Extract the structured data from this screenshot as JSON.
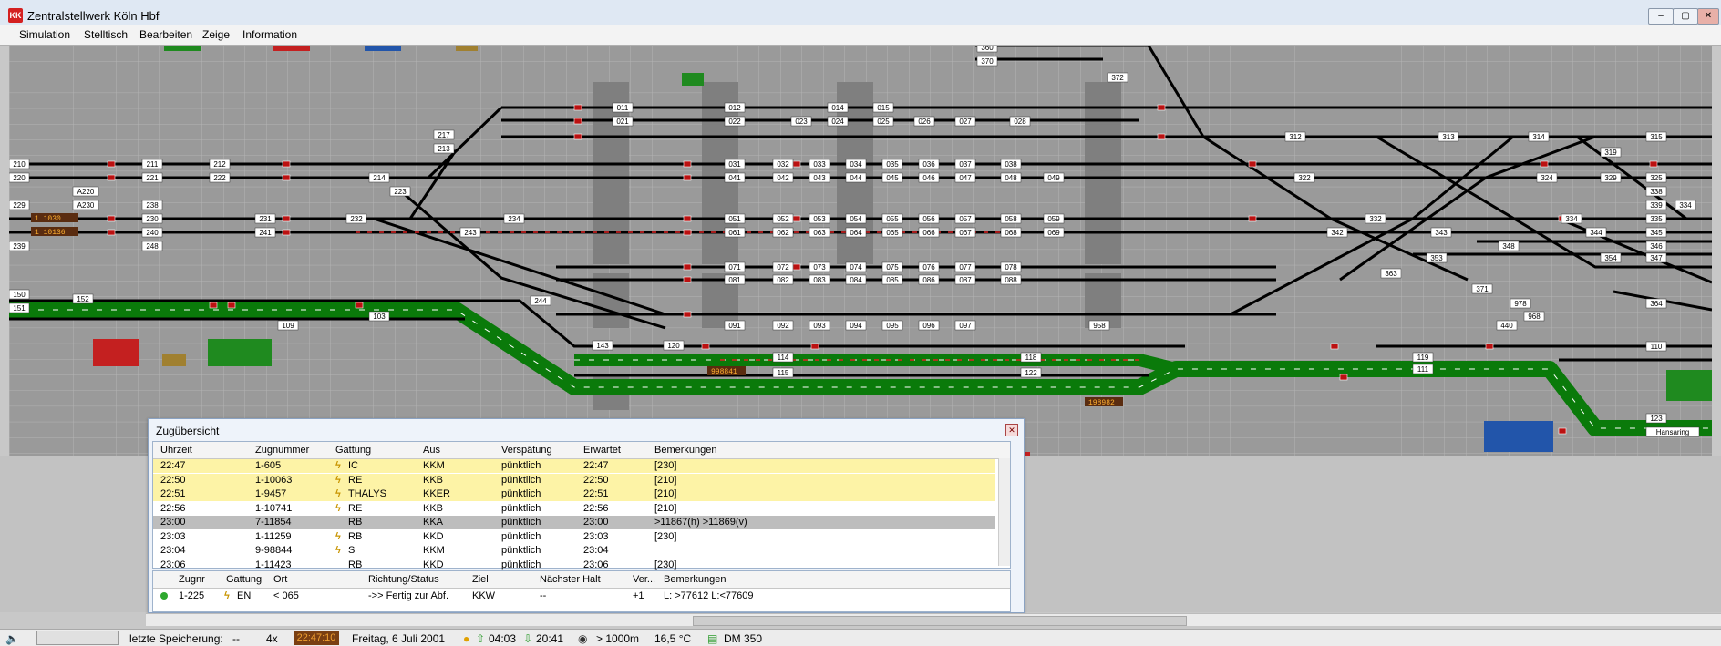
{
  "window": {
    "title": "Zentralstellwerk Köln Hbf",
    "icon_label": "KK"
  },
  "menu": [
    "Simulation",
    "Stelltisch",
    "Bearbeiten",
    "Zeige",
    "Information"
  ],
  "track_labels": [
    "360",
    "370",
    "372",
    "011",
    "012",
    "014",
    "015",
    "021",
    "022",
    "023",
    "024",
    "025",
    "026",
    "027",
    "028",
    "217",
    "213",
    "210",
    "211",
    "212",
    "031",
    "032",
    "033",
    "034",
    "035",
    "036",
    "037",
    "038",
    "312",
    "313",
    "314",
    "315",
    "319",
    "220",
    "221",
    "222",
    "214",
    "041",
    "042",
    "043",
    "044",
    "045",
    "046",
    "047",
    "048",
    "049",
    "322",
    "324",
    "325",
    "329",
    "223",
    "A220",
    "A230",
    "229",
    "238",
    "338",
    "339",
    "334",
    "230",
    "231",
    "232",
    "234",
    "051",
    "052",
    "053",
    "054",
    "055",
    "056",
    "057",
    "058",
    "059",
    "342",
    "332",
    "334",
    "335",
    "240",
    "241",
    "243",
    "061",
    "062",
    "063",
    "064",
    "065",
    "066",
    "067",
    "068",
    "069",
    "343",
    "344",
    "345",
    "239",
    "248",
    "348",
    "346",
    "071",
    "072",
    "073",
    "074",
    "075",
    "076",
    "077",
    "078",
    "353",
    "354",
    "347",
    "363",
    "150",
    "081",
    "082",
    "083",
    "084",
    "085",
    "086",
    "087",
    "088",
    "371",
    "244",
    "978",
    "152",
    "364",
    "151",
    "109",
    "103",
    "968",
    "091",
    "092",
    "093",
    "094",
    "095",
    "096",
    "097",
    "958",
    "440",
    "143",
    "120",
    "110",
    "114",
    "118",
    "119",
    "111",
    "115",
    "122",
    "123",
    "Hansaring"
  ],
  "counters": [
    "1 1030",
    "1 10136",
    "998841",
    "198982"
  ],
  "train_overview": {
    "title": "Zugübersicht",
    "columns": [
      "Uhrzeit",
      "Zugnummer",
      "Gattung",
      "Aus",
      "Verspätung",
      "Erwartet",
      "Bemerkungen"
    ],
    "rows": [
      {
        "time": "22:47",
        "number": "1-605",
        "bolt": true,
        "type": "IC",
        "from": "KKM",
        "delay": "pünktlich",
        "expected": "22:47",
        "remarks": "[230]",
        "highlight": "yellow"
      },
      {
        "time": "22:50",
        "number": "1-10063",
        "bolt": true,
        "type": "RE",
        "from": "KKB",
        "delay": "pünktlich",
        "expected": "22:50",
        "remarks": "[210]",
        "highlight": "yellow"
      },
      {
        "time": "22:51",
        "number": "1-9457",
        "bolt": true,
        "type": "THALYS",
        "from": "KKER",
        "delay": "pünktlich",
        "expected": "22:51",
        "remarks": "[210]",
        "highlight": "yellow"
      },
      {
        "time": "22:56",
        "number": "1-10741",
        "bolt": true,
        "type": "RE",
        "from": "KKB",
        "delay": "pünktlich",
        "expected": "22:56",
        "remarks": "[210]",
        "highlight": "none"
      },
      {
        "time": "23:00",
        "number": "7-11854",
        "bolt": false,
        "type": "RB",
        "from": "KKA",
        "delay": "pünktlich",
        "expected": "23:00",
        "remarks": ">11867(h) >11869(v)",
        "highlight": "grey"
      },
      {
        "time": "23:03",
        "number": "1-11259",
        "bolt": true,
        "type": "RB",
        "from": "KKD",
        "delay": "pünktlich",
        "expected": "23:03",
        "remarks": "[230]",
        "highlight": "none"
      },
      {
        "time": "23:04",
        "number": "9-98844",
        "bolt": true,
        "type": "S",
        "from": "KKM",
        "delay": "pünktlich",
        "expected": "23:04",
        "remarks": "",
        "highlight": "none"
      },
      {
        "time": "23:06",
        "number": "1-11423",
        "bolt": false,
        "type": "RB",
        "from": "KKD",
        "delay": "pünktlich",
        "expected": "23:06",
        "remarks": "[230]",
        "highlight": "none"
      }
    ],
    "detail_columns": [
      "Zugnr",
      "Gattung",
      "Ort",
      "Richtung/Status",
      "Ziel",
      "Nächster Halt",
      "Ver...",
      "Bemerkungen"
    ],
    "detail_row": {
      "number": "1-225",
      "type": "EN",
      "location": "< 065",
      "status": "->> Fertig zur Abf.",
      "target": "KKW",
      "next_stop": "--",
      "delay": "+1",
      "remarks": "L: >77612 L:<77609"
    }
  },
  "status": {
    "last_save_label": "letzte Speicherung:",
    "last_save_value": "--",
    "speed": "4x",
    "clock": "22:47:10",
    "date": "Freitag, 6 Juli 2001",
    "sunrise": "04:03",
    "sunset": "20:41",
    "visibility": "> 1000m",
    "temperature": "16,5 °C",
    "money": "DM 350"
  },
  "colors": {
    "canvas": "#9a9a9a",
    "track": "#000000",
    "occupied": "#0a7a0a",
    "highlight_yellow": "#fdf3a6",
    "highlight_grey": "#bdbdbd",
    "clock_bg": "#7a3f12"
  }
}
